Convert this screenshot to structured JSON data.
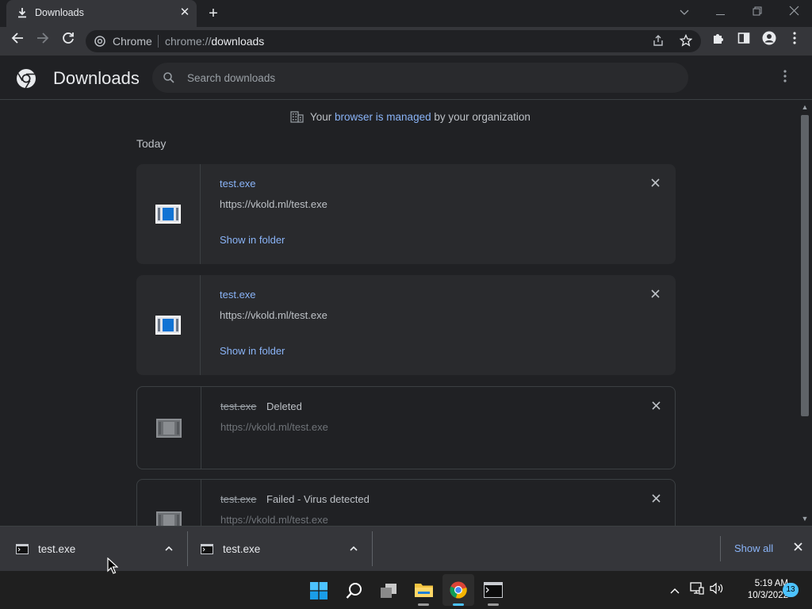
{
  "window": {
    "tab_title": "Downloads",
    "tab_close": "✕",
    "new_tab": "+"
  },
  "toolbar": {
    "site_label": "Chrome",
    "url_scheme": "chrome://",
    "url_host": "downloads"
  },
  "page": {
    "title": "Downloads",
    "search_placeholder": "Search downloads",
    "managed_prefix": "Your ",
    "managed_link": "browser is managed",
    "managed_suffix": " by your organization",
    "section_today": "Today"
  },
  "downloads": [
    {
      "filename": "test.exe",
      "url": "https://vkold.ml/test.exe",
      "action": "Show in folder",
      "status": ""
    },
    {
      "filename": "test.exe",
      "url": "https://vkold.ml/test.exe",
      "action": "Show in folder",
      "status": ""
    },
    {
      "filename": "test.exe",
      "url": "https://vkold.ml/test.exe",
      "action": "",
      "status": "Deleted"
    },
    {
      "filename": "test.exe",
      "url": "https://vkold.ml/test.exe",
      "action": "",
      "status": "Failed - Virus detected"
    }
  ],
  "shelf": {
    "items": [
      {
        "name": "test.exe"
      },
      {
        "name": "test.exe"
      }
    ],
    "show_all": "Show all"
  },
  "taskbar": {
    "time": "5:19 AM",
    "date": "10/3/2022",
    "notification_count": "13"
  },
  "colors": {
    "accent_link": "#8ab4f8",
    "background": "#202124",
    "card": "#292a2d",
    "taskbar_accent": "#4cc2ff"
  },
  "icons": {
    "tab": "download-icon",
    "back": "back-arrow-icon",
    "forward": "forward-arrow-icon",
    "reload": "reload-icon",
    "share": "share-icon",
    "bookmark": "star-icon",
    "extensions": "puzzle-icon",
    "side_panel": "side-panel-icon",
    "profile": "profile-icon",
    "menu": "kebab-menu-icon",
    "search": "search-icon",
    "managed": "building-icon",
    "file": "exe-file-icon"
  }
}
